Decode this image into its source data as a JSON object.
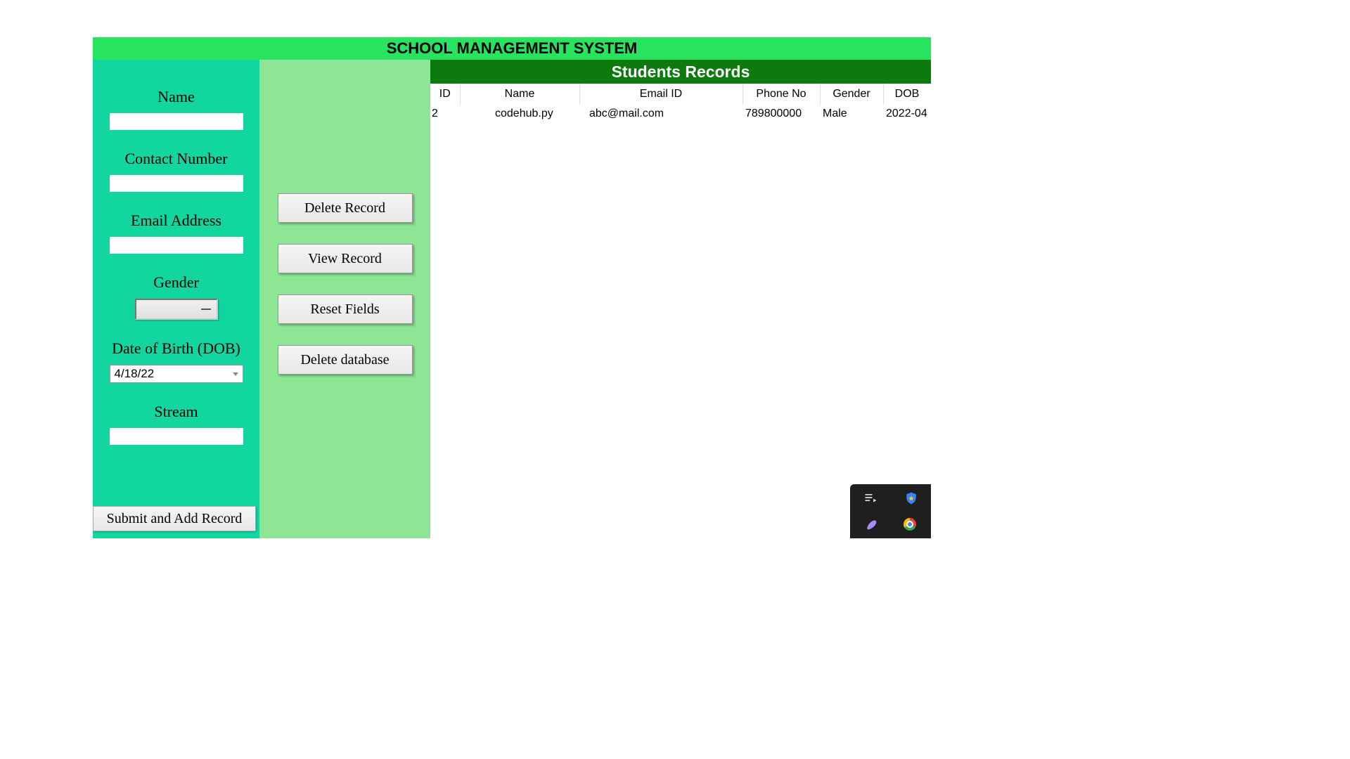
{
  "title": "SCHOOL MANAGEMENT SYSTEM",
  "form": {
    "name_label": "Name",
    "name_value": "",
    "contact_label": "Contact Number",
    "contact_value": "",
    "email_label": "Email Address",
    "email_value": "",
    "gender_label": "Gender",
    "gender_value": "",
    "dob_label": "Date of Birth (DOB)",
    "dob_value": "4/18/22",
    "stream_label": "Stream",
    "stream_value": "",
    "submit_label": "Submit and Add Record"
  },
  "actions": {
    "delete_record": "Delete Record",
    "view_record": "View Record",
    "reset_fields": "Reset Fields",
    "delete_database": "Delete database"
  },
  "records": {
    "heading": "Students Records",
    "columns": {
      "id": "ID",
      "name": "Name",
      "email": "Email ID",
      "phone": "Phone No",
      "gender": "Gender",
      "dob": "DOB"
    },
    "rows": [
      {
        "id": "2",
        "name": "codehub.py",
        "email": "abc@mail.com",
        "phone": "789800000",
        "gender": "Male",
        "dob": "2022-04"
      }
    ]
  }
}
